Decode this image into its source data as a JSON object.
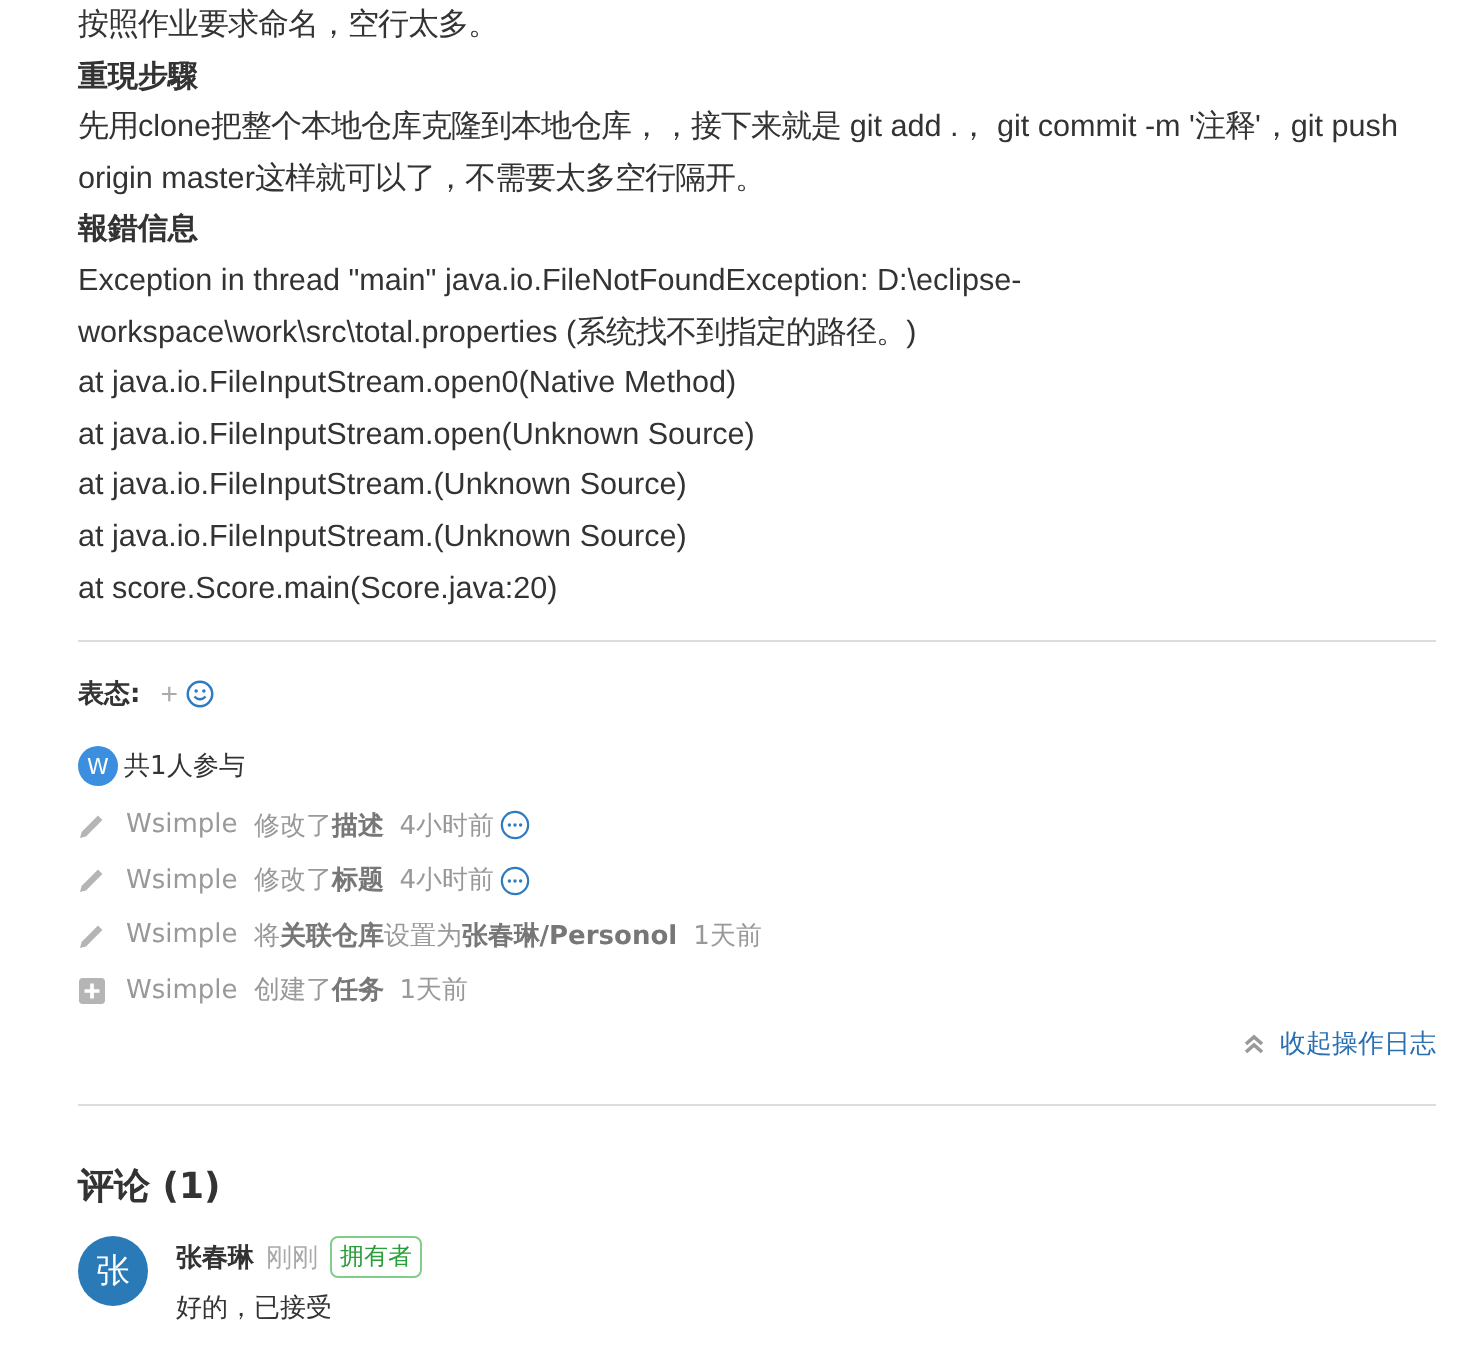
{
  "description": {
    "intro": "按照作业要求命名，空行太多。",
    "sections": [
      {
        "heading": "重現步驟",
        "lines": [
          "先用clone把整个本地仓库克隆到本地仓库，，接下来就是 git add .，  git commit -m '注释'，git push origin master这样就可以了，不需要太多空行隔开。"
        ]
      },
      {
        "heading": "報錯信息",
        "lines": [
          "Exception in thread \"main\" java.io.FileNotFoundException: D:\\eclipse-workspace\\work\\src\\total.properties (系统找不到指定的路径。)",
          "at java.io.FileInputStream.open0(Native Method)",
          "at java.io.FileInputStream.open(Unknown Source)",
          "at java.io.FileInputStream.(Unknown Source)",
          "at java.io.FileInputStream.(Unknown Source)",
          "at score.Score.main(Score.java:20)"
        ]
      }
    ]
  },
  "reactions": {
    "label": "表态:",
    "add": "+"
  },
  "participants": {
    "avatar": "W",
    "text": "共1人参与"
  },
  "log": [
    {
      "kind": "edit",
      "user": "Wsimple",
      "action": "修改了**描述**",
      "time": "4小时前",
      "more": true
    },
    {
      "kind": "edit",
      "user": "Wsimple",
      "action": "修改了**标题**",
      "time": "4小时前",
      "more": true
    },
    {
      "kind": "edit",
      "user": "Wsimple",
      "action": "将**关联仓库**设置为**张春琳/Personol**",
      "time": "1天前",
      "more": false
    },
    {
      "kind": "create",
      "user": "Wsimple",
      "action": "创建了**任务**",
      "time": "1天前",
      "more": false
    }
  ],
  "collapse_log": "收起操作日志",
  "comments": {
    "title": "评论 (1)",
    "items": [
      {
        "avatar": "张",
        "author": "张春琳",
        "time": "刚刚",
        "badge": "拥有者",
        "text": "好的，已接受"
      }
    ]
  }
}
